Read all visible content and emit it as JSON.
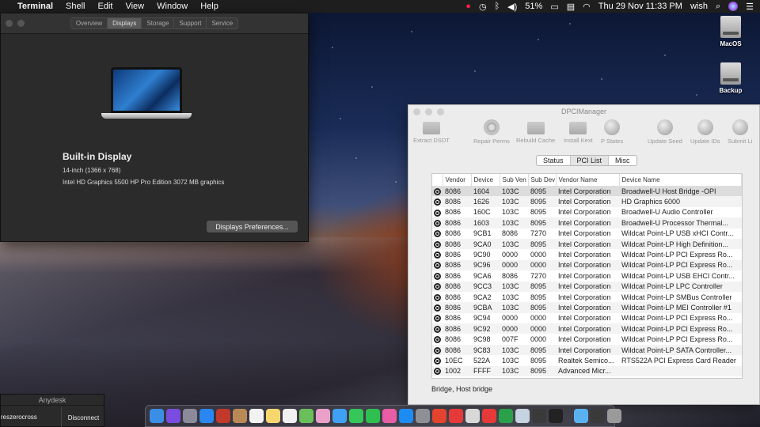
{
  "menubar": {
    "apple": "",
    "app": "Terminal",
    "menus": [
      "Shell",
      "Edit",
      "View",
      "Window",
      "Help"
    ],
    "battery": "51%",
    "datetime": "Thu 29 Nov  11:33 PM",
    "user": "wish",
    "status_icons": [
      "antivirus-icon",
      "time-machine-icon",
      "bluetooth-icon",
      "volume-icon",
      "battery-icon",
      "input-menu-icon",
      "wifi-icon",
      "spotlight-icon",
      "siri-icon",
      "notification-center-icon"
    ]
  },
  "sysinfo": {
    "tabs": [
      "Overview",
      "Displays",
      "Storage",
      "Support",
      "Service"
    ],
    "active_tab": "Displays",
    "display_title": "Built-in Display",
    "display_size": "14-inch (1366 x 768)",
    "display_gpu": "Intel HD Graphics 5500 HP Pro Edition 3072 MB graphics",
    "prefs_button": "Displays Preferences..."
  },
  "desktop": {
    "drives": [
      "MacOS",
      "Backup"
    ]
  },
  "dpci": {
    "title": "DPCIManager",
    "tools": [
      "Extract DSDT",
      "Repair Perms",
      "Rebuild Cache",
      "Install Kext",
      "P States",
      "Update Seed",
      "Update IDs",
      "Submit Li"
    ],
    "tabs": [
      "Status",
      "PCI List",
      "Misc"
    ],
    "active_tab": "PCI List",
    "columns": [
      "",
      "Vendor",
      "Device",
      "Sub Ven",
      "Sub Dev",
      "Vendor Name",
      "Device Name"
    ],
    "rows": [
      [
        "8086",
        "1604",
        "103C",
        "8095",
        "Intel Corporation",
        "Broadwell-U Host Bridge -OPI"
      ],
      [
        "8086",
        "1626",
        "103C",
        "8095",
        "Intel Corporation",
        "HD Graphics 6000"
      ],
      [
        "8086",
        "160C",
        "103C",
        "8095",
        "Intel Corporation",
        "Broadwell-U Audio Controller"
      ],
      [
        "8086",
        "1603",
        "103C",
        "8095",
        "Intel Corporation",
        "Broadwell-U Processor Thermal..."
      ],
      [
        "8086",
        "9CB1",
        "8086",
        "7270",
        "Intel Corporation",
        "Wildcat Point-LP USB xHCI Contr..."
      ],
      [
        "8086",
        "9CA0",
        "103C",
        "8095",
        "Intel Corporation",
        "Wildcat Point-LP High Definition..."
      ],
      [
        "8086",
        "9C90",
        "0000",
        "0000",
        "Intel Corporation",
        "Wildcat Point-LP PCI Express Ro..."
      ],
      [
        "8086",
        "9C96",
        "0000",
        "0000",
        "Intel Corporation",
        "Wildcat Point-LP PCI Express Ro..."
      ],
      [
        "8086",
        "9CA6",
        "8086",
        "7270",
        "Intel Corporation",
        "Wildcat Point-LP USB EHCI Contr..."
      ],
      [
        "8086",
        "9CC3",
        "103C",
        "8095",
        "Intel Corporation",
        "Wildcat Point-LP LPC Controller"
      ],
      [
        "8086",
        "9CA2",
        "103C",
        "8095",
        "Intel Corporation",
        "Wildcat Point-LP SMBus Controller"
      ],
      [
        "8086",
        "9CBA",
        "103C",
        "8095",
        "Intel Corporation",
        "Wildcat Point-LP MEI Controller #1"
      ],
      [
        "8086",
        "9C94",
        "0000",
        "0000",
        "Intel Corporation",
        "Wildcat Point-LP PCI Express Ro..."
      ],
      [
        "8086",
        "9C92",
        "0000",
        "0000",
        "Intel Corporation",
        "Wildcat Point-LP PCI Express Ro..."
      ],
      [
        "8086",
        "9C98",
        "007F",
        "0000",
        "Intel Corporation",
        "Wildcat Point-LP PCI Express Ro..."
      ],
      [
        "8086",
        "9C83",
        "103C",
        "8095",
        "Intel Corporation",
        "Wildcat Point-LP SATA Controller..."
      ],
      [
        "10EC",
        "522A",
        "103C",
        "8095",
        "Realtek Semico...",
        "RTS522A PCI Express Card Reader"
      ],
      [
        "1002",
        "FFFF",
        "103C",
        "8095",
        "Advanced Micr...",
        ""
      ]
    ],
    "selected_row": 0,
    "status_text": "Bridge, Host bridge"
  },
  "anydesk": {
    "title": "Anydesk",
    "user": "reszerocross",
    "button": "Disconnect"
  },
  "dock": {
    "apps": [
      {
        "name": "finder",
        "color": "#3a8ee6"
      },
      {
        "name": "siri",
        "color": "#7a4de0"
      },
      {
        "name": "launchpad",
        "color": "#8a8a9a"
      },
      {
        "name": "safari",
        "color": "#2a86f0"
      },
      {
        "name": "photo-booth",
        "color": "#c0392b"
      },
      {
        "name": "contacts",
        "color": "#b98a55"
      },
      {
        "name": "calendar",
        "color": "#f2f2f2"
      },
      {
        "name": "notes",
        "color": "#f5d76e"
      },
      {
        "name": "reminders",
        "color": "#f0f0f0"
      },
      {
        "name": "maps",
        "color": "#6bbf5a"
      },
      {
        "name": "photos",
        "color": "#e9a0c9"
      },
      {
        "name": "messages-blue",
        "color": "#3fa0f5"
      },
      {
        "name": "messages",
        "color": "#35c759"
      },
      {
        "name": "facetime",
        "color": "#2fbf50"
      },
      {
        "name": "itunes",
        "color": "#e85ea4"
      },
      {
        "name": "app-store",
        "color": "#1c8cf2"
      },
      {
        "name": "system-preferences",
        "color": "#8f8f96"
      },
      {
        "name": "chrome",
        "color": "#e4432d"
      },
      {
        "name": "anydesk",
        "color": "#e63a3a"
      },
      {
        "name": "acrobat",
        "color": "#d8d8d8"
      },
      {
        "name": "anydesk-2",
        "color": "#e63a3a"
      },
      {
        "name": "xcode-helper",
        "color": "#2aa04a"
      },
      {
        "name": "preview",
        "color": "#c6d3e0"
      },
      {
        "name": "activity-monitor",
        "color": "#3a3a3a"
      },
      {
        "name": "terminal",
        "color": "#222"
      },
      {
        "name": "downloads-folder",
        "color": "#5ab3f0"
      },
      {
        "name": "screenshots",
        "color": "#3a3a3a"
      },
      {
        "name": "trash",
        "color": "#9a9a9a"
      }
    ]
  }
}
